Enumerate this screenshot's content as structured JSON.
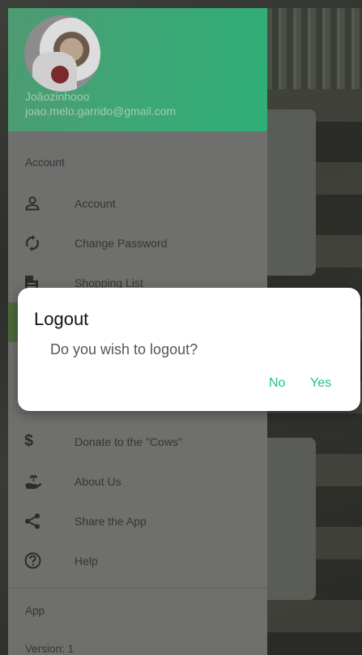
{
  "user": {
    "name": "Joãozinhooo",
    "email": "joao.melo.garrido@gmail.com"
  },
  "sections": {
    "account": "Account",
    "app": "App"
  },
  "nav": {
    "account": "Account",
    "change_password": "Change Password",
    "shopping_list": "Shopping List",
    "donate": "Donate to the \"Cows\"",
    "about": "About Us",
    "share": "Share the App",
    "help": "Help"
  },
  "app": {
    "version": "Version: 1"
  },
  "dialog": {
    "title": "Logout",
    "message": "Do you wish to logout?",
    "no": "No",
    "yes": "Yes"
  },
  "colors": {
    "accent": "#1fbf8a",
    "header": "#3da775"
  }
}
